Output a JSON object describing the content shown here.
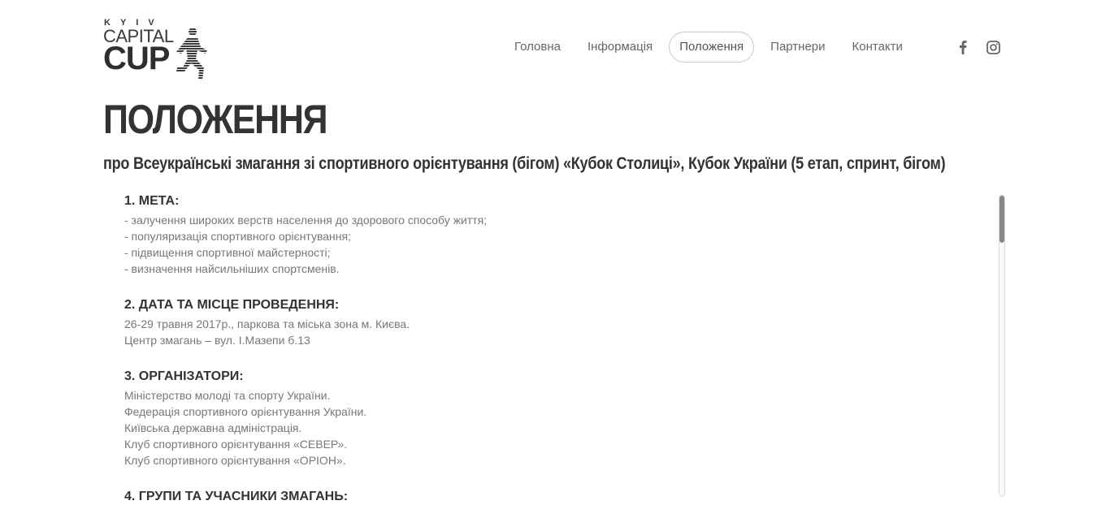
{
  "logo": {
    "top_text": "KYIV",
    "middle_text": "CAPITAL",
    "bottom_text": "CUP"
  },
  "nav": {
    "items": [
      {
        "label": "Головна",
        "active": false
      },
      {
        "label": "Інформація",
        "active": false
      },
      {
        "label": "Положення",
        "active": true
      },
      {
        "label": "Партнери",
        "active": false
      },
      {
        "label": "Контакти",
        "active": false
      }
    ]
  },
  "social": {
    "icons": [
      "facebook-icon",
      "instagram-icon"
    ]
  },
  "page": {
    "title": "ПОЛОЖЕННЯ",
    "subtitle": "про Всеукраїнські змагання зі спортивного орієнтування (бігом) «Кубок Столиці», Кубок України (5 етап, спринт, бігом)"
  },
  "sections": [
    {
      "heading": "1. МЕТА:",
      "lines": [
        "- залучення широких верств населення до здорового способу життя;",
        "- популяризація спортивного орієнтування;",
        "- підвищення спортивної майстерності;",
        "- визначення найсильніших спортсменів."
      ]
    },
    {
      "heading": "2. ДАТА ТА МІСЦЕ ПРОВЕДЕННЯ:",
      "lines": [
        "26-29 травня 2017р., паркова та міська зона м. Києва.",
        "Центр змагань – вул. І.Мазепи б.13"
      ]
    },
    {
      "heading": "3. ОРГАНІЗАТОРИ:",
      "lines": [
        "Міністерство молоді та спорту України.",
        "Федерація спортивного орієнтування України.",
        "Київська державна адміністрація.",
        "Клуб спортивного орієнтування «СЕВЕР».",
        "Клуб спортивного орієнтування «ОРІОН»."
      ]
    },
    {
      "heading": "4. ГРУПИ ТА УЧАСНИКИ ЗМАГАНЬ:",
      "lines": []
    }
  ],
  "colors": {
    "heading": "#333333",
    "body_text": "#777777",
    "nav_text": "#666666",
    "nav_active_border": "#c9c9c9"
  }
}
